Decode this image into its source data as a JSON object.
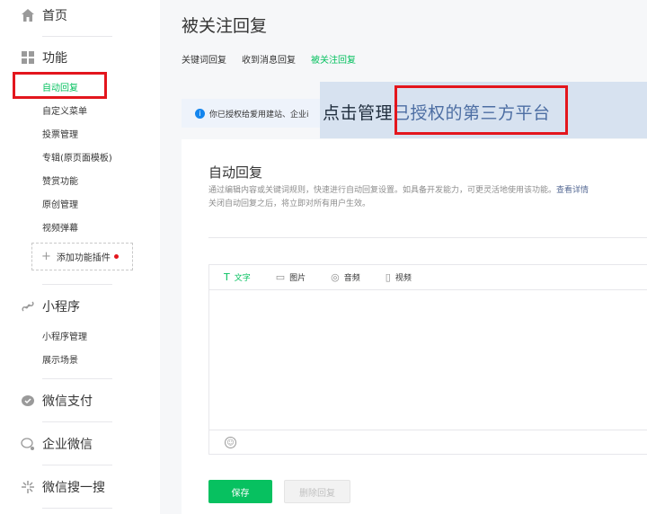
{
  "sidebar": {
    "home_label": "首页",
    "home_icon": "home-icon",
    "features_label": "功能",
    "features_icon": "grid-icon",
    "features_items": [
      "自动回复",
      "自定义菜单",
      "投票管理",
      "专辑(原页面模板)",
      "赞赏功能",
      "原创管理",
      "视频弹幕"
    ],
    "add_plugin_label": "添加功能插件",
    "miniprogram_label": "小程序",
    "miniprogram_icon": "link-icon",
    "miniprogram_items": [
      "小程序管理",
      "展示场景"
    ],
    "pay_label": "微信支付",
    "pay_icon": "wechat-pay-icon",
    "work_label": "企业微信",
    "work_icon": "work-wechat-icon",
    "search_label": "微信搜一搜",
    "search_icon": "sparkle-icon"
  },
  "header": {
    "title": "被关注回复",
    "tabs": [
      "关键词回复",
      "收到消息回复",
      "被关注回复"
    ],
    "active_tab": "被关注回复"
  },
  "notice": {
    "text": "你已授权给爱用建站、企业i",
    "overlay_text_prefix": "点击管理",
    "overlay_text_highlight": "已授权的第三方平台"
  },
  "section": {
    "title": "自动回复",
    "desc_line1": "通过编辑内容或关键词规则，快速进行自动回复设置。如具备开发能力，可更灵活地使用该功能。",
    "desc_link": "查看详情",
    "desc_line2": "关闭自动回复之后，将立即对所有用户生效。"
  },
  "editor": {
    "tabs": [
      {
        "icon": "text-icon",
        "glyph": "T",
        "label": "文字"
      },
      {
        "icon": "image-icon",
        "glyph": "▭",
        "label": "图片"
      },
      {
        "icon": "audio-icon",
        "glyph": "◎",
        "label": "音频"
      },
      {
        "icon": "video-icon",
        "glyph": "▯",
        "label": "视频"
      }
    ],
    "emoji_icon": "emoji-icon"
  },
  "buttons": {
    "save": "保存",
    "delete": "删除回复"
  },
  "colors": {
    "accent": "#07c160",
    "annotation_red": "#e3161d",
    "link": "#576b95"
  }
}
